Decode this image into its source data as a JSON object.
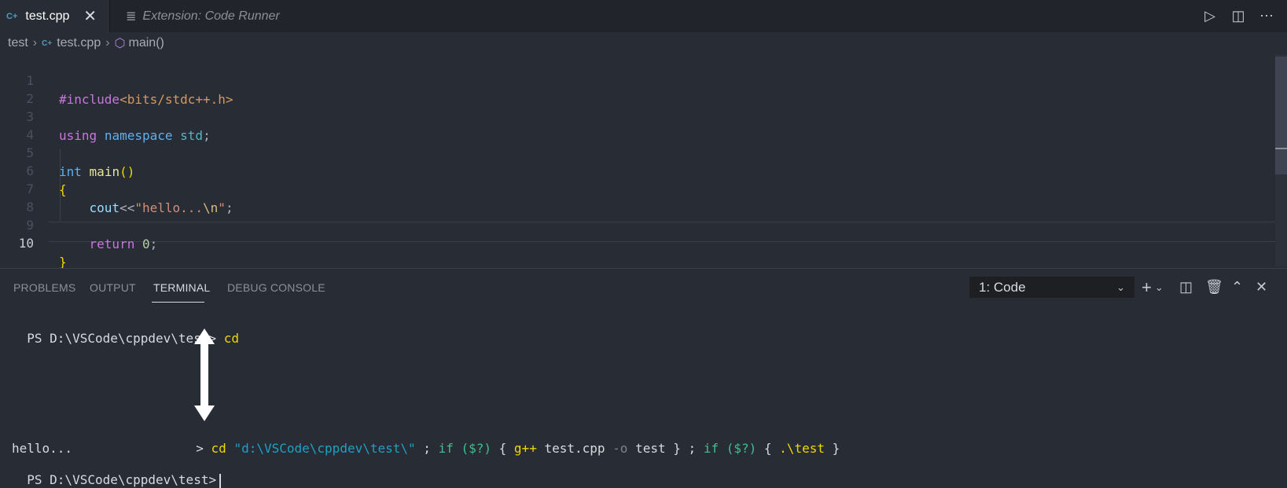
{
  "tabs": [
    {
      "icon": "cpp-file-icon",
      "label": "test.cpp",
      "active": true
    },
    {
      "icon": "document-icon",
      "label": "Extension: Code Runner",
      "active": false
    }
  ],
  "breadcrumb": {
    "folder": "test",
    "file": "test.cpp",
    "symbol": "main()"
  },
  "editor": {
    "line_numbers": [
      "1",
      "2",
      "3",
      "4",
      "5",
      "6",
      "7",
      "8",
      "9",
      "10"
    ],
    "current_line": 10,
    "lines": [
      {
        "directive": "#include",
        "header": "<bits/stdc++.h>"
      },
      {},
      {
        "kw": "using",
        "kw2": "namespace",
        "ns": "std",
        "end": ";"
      },
      {},
      {
        "type": "int",
        "name": "main",
        "parens": "()"
      },
      {
        "brace": "{"
      },
      {
        "obj": "cout",
        "op": "<<",
        "str": "\"hello...",
        "esc": "\\n",
        "strend": "\"",
        "end": ";"
      },
      {},
      {
        "kw": "return",
        "num": "0",
        "end": ";"
      },
      {
        "brace": "}"
      }
    ]
  },
  "panel": {
    "tabs": [
      "PROBLEMS",
      "OUTPUT",
      "TERMINAL",
      "DEBUG CONSOLE"
    ],
    "active_tab": "TERMINAL",
    "terminal_select": "1: Code",
    "terminal": {
      "line1_prompt": "PS D:\\VSCode\\cppdev\\test>",
      "line1_cmd": "cd",
      "line2": {
        "prefix": ">",
        "cd": "cd",
        "path": "\"d:\\VSCode\\cppdev\\test\\\"",
        "semi1": ";",
        "if1": "if",
        "cond1": "($?)",
        "ob1": "{",
        "gpp": "g++",
        "args1": "test.cpp",
        "flag": "-o",
        "args2": "test",
        "cb1": "}",
        "semi2": ";",
        "if2": "if",
        "cond2": "($?)",
        "ob2": "{",
        "run": ".\\test",
        "cb2": "}"
      },
      "output": "hello...",
      "last_prompt": "PS D:\\VSCode\\cppdev\\test>"
    }
  }
}
